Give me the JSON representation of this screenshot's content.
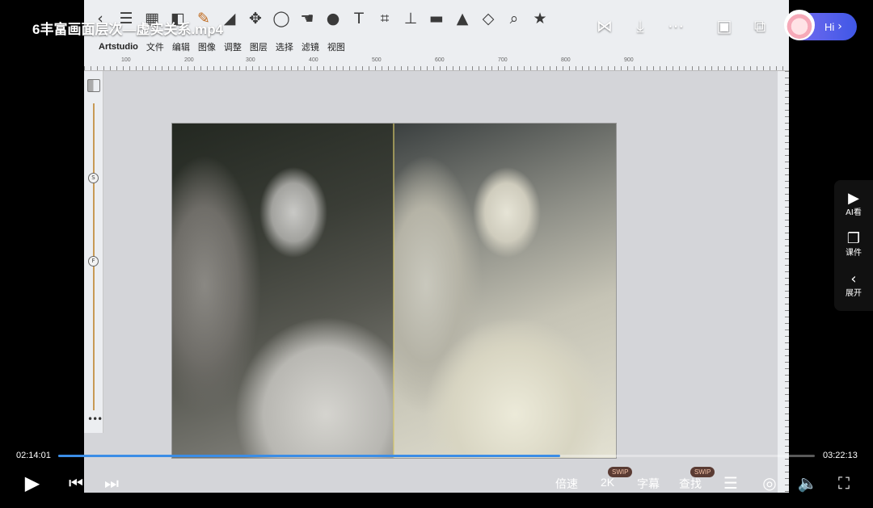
{
  "video": {
    "title": "6丰富画面层次—虚实关系.mp4",
    "time_current": "02:14:01",
    "time_total": "03:22:13",
    "progress": 0.663
  },
  "app": {
    "menu": [
      "Artstudio",
      "文件",
      "编辑",
      "图像",
      "调整",
      "图层",
      "选择",
      "滤镜",
      "视图"
    ],
    "ruler_numbers": [
      "100",
      "200",
      "300",
      "400",
      "500",
      "600",
      "700",
      "800",
      "900"
    ],
    "slider_labels": [
      "S",
      "F"
    ],
    "more_glyph": "•••"
  },
  "top_bar": {
    "hi_label": "Hi",
    "hi_chevron": "›"
  },
  "side_tools": [
    {
      "label": "AI看",
      "icon": "ai-view-icon"
    },
    {
      "label": "课件",
      "icon": "courseware-icon"
    },
    {
      "label": "展开",
      "icon": "chevron-left-icon"
    }
  ],
  "controls": {
    "speed_label": "倍速",
    "quality_label": "2K",
    "subtitle_label": "字幕",
    "search_label": "查找",
    "swip_badge": "SWIP"
  },
  "colors": {
    "progress": "#3b8de6",
    "hi_pill_start": "#7b6ef0",
    "hi_pill_end": "#3f57e6"
  }
}
